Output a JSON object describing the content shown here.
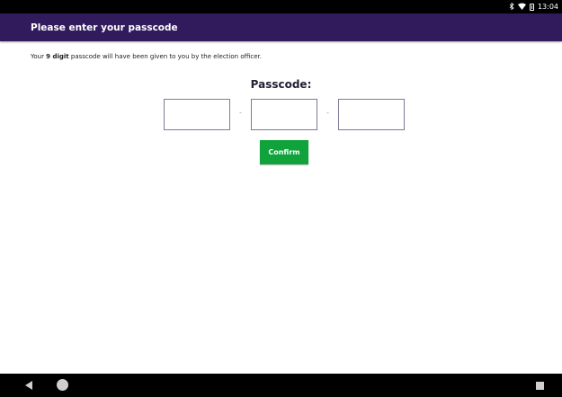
{
  "status_bar": {
    "time": "13:04",
    "icons": [
      "bluetooth-icon",
      "wifi-icon",
      "battery-icon"
    ]
  },
  "app_bar": {
    "title": "Please enter your passcode"
  },
  "instruction": {
    "prefix": "Your ",
    "emphasis": "9 digit",
    "suffix": " passcode will have been given to you by the election officer."
  },
  "passcode": {
    "label": "Passcode:",
    "separator": "-",
    "fields": [
      {
        "value": "",
        "placeholder": ""
      },
      {
        "value": "",
        "placeholder": ""
      },
      {
        "value": "",
        "placeholder": ""
      }
    ]
  },
  "confirm": {
    "label": "Confirm",
    "color": "#11a33b"
  },
  "colors": {
    "app_bar": "#311b5c",
    "confirm": "#11a33b"
  },
  "nav_bar": {
    "icons": [
      "back-icon",
      "home-icon",
      "recents-icon"
    ]
  }
}
